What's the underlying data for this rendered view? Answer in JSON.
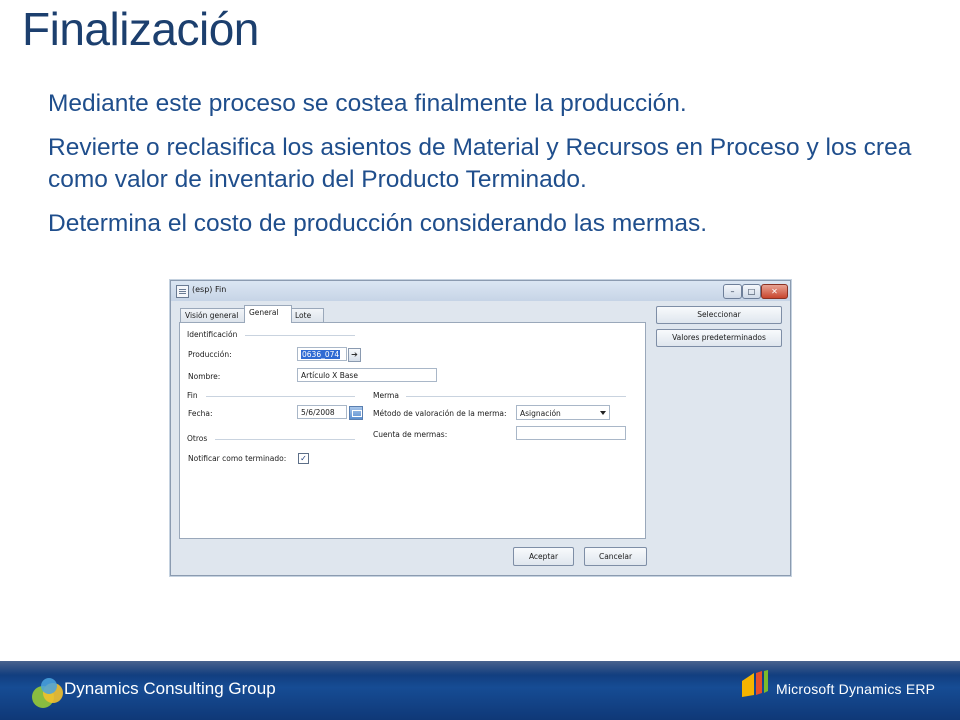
{
  "slide": {
    "title": "Finalización",
    "bullets": [
      "Mediante este proceso se costea finalmente la producción.",
      "Revierte o reclasifica los asientos de Material y Recursos en Proceso y los crea como valor de inventario del Producto Terminado.",
      "Determina el costo de producción considerando las mermas."
    ]
  },
  "window": {
    "title": "(esp) Fin",
    "controls": {
      "minimize": "–",
      "maximize": "□",
      "close": "✕"
    },
    "tabs": [
      "Visión general",
      "General",
      "Lote"
    ],
    "active_tab": "General",
    "groups": {
      "identificacion": "Identificación",
      "fin": "Fin",
      "otros": "Otros",
      "merma": "Merma"
    },
    "fields": {
      "produccion_label": "Producción:",
      "produccion_value": "0636_074",
      "nombre_label": "Nombre:",
      "nombre_value": "Artículo X Base",
      "fecha_label": "Fecha:",
      "fecha_value": "5/6/2008",
      "notificar_label": "Notificar como terminado:",
      "notificar_checked": "✓",
      "metodo_label": "Método de valoración de la merma:",
      "metodo_value": "Asignación",
      "cuenta_label": "Cuenta de mermas:",
      "cuenta_value": ""
    },
    "side_buttons": [
      "Seleccionar",
      "Valores predeterminados"
    ],
    "footer_buttons": {
      "ok": "Aceptar",
      "cancel": "Cancelar"
    }
  },
  "footer": {
    "left_brand": "Dynamics Consulting Group",
    "right_brand": "Microsoft Dynamics ERP"
  },
  "icons": {
    "window_icon": "form-icon",
    "lookup": "lookup-arrow-icon",
    "calendar": "calendar-icon",
    "dropdown": "chevron-down-icon"
  },
  "colors": {
    "title": "#1c3f6e",
    "bullet_text": "#1f4e8c",
    "footer_bar": "#164c94"
  }
}
